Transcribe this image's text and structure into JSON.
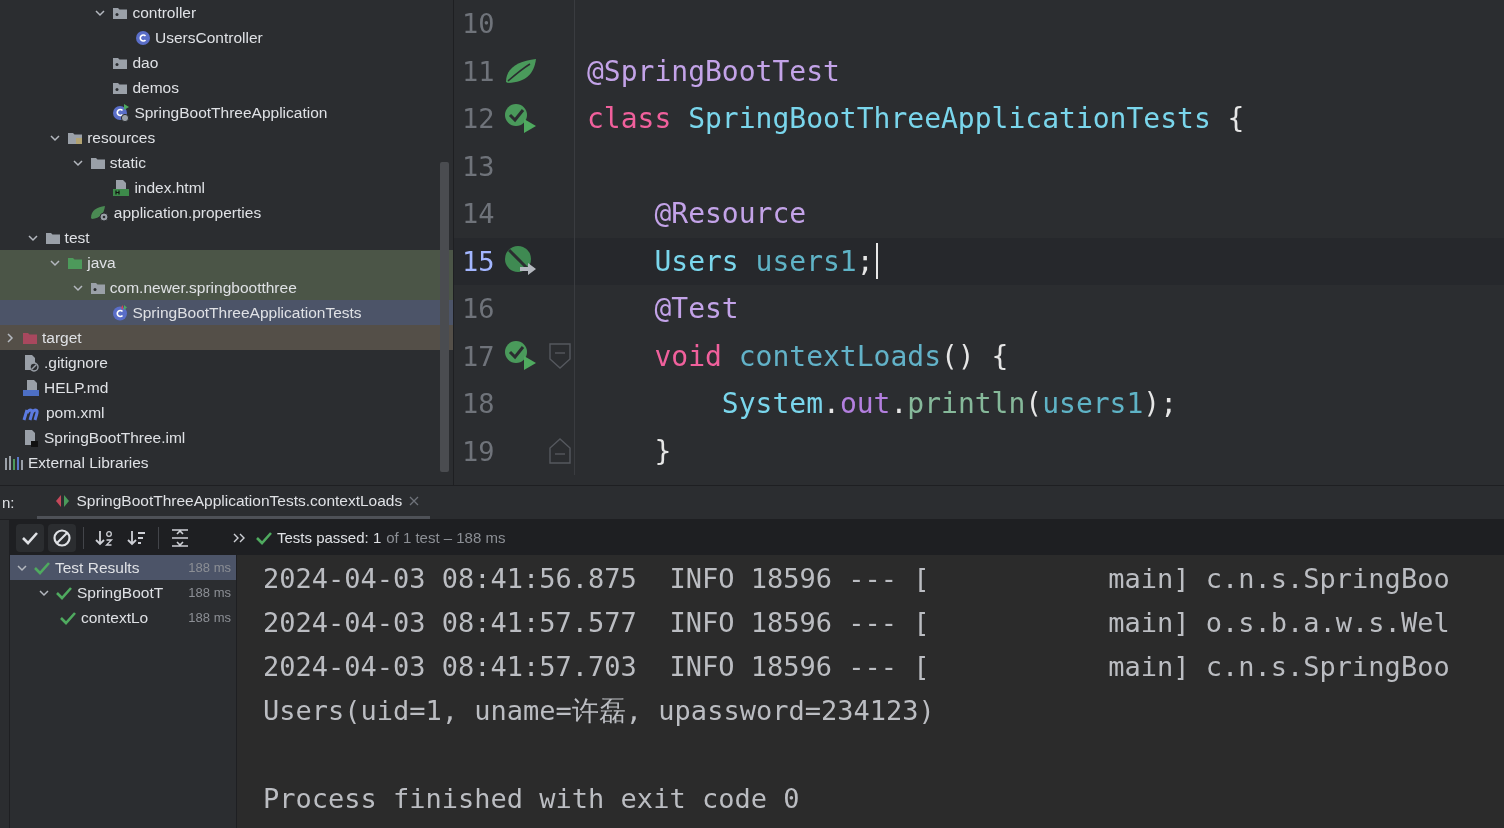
{
  "project_tree": {
    "items": [
      {
        "children": [
          {
            "children": [
              {
                "children": [
                  {
                    "children": [
                      {
                        "label": "controller",
                        "kind": "package",
                        "expanded": true,
                        "children": [
                          {
                            "label": "UsersController",
                            "kind": "class"
                          }
                        ]
                      },
                      {
                        "label": "dao",
                        "kind": "package"
                      },
                      {
                        "label": "demos",
                        "kind": "package"
                      },
                      {
                        "label": "SpringBootThreeApplication",
                        "kind": "spring-app"
                      }
                    ]
                  }
                ]
              },
              {
                "label": "resources",
                "kind": "resources",
                "expanded": true,
                "children": [
                  {
                    "label": "static",
                    "kind": "folder",
                    "expanded": true,
                    "children": [
                      {
                        "label": "index.html",
                        "kind": "html"
                      }
                    ]
                  },
                  {
                    "label": "application.properties",
                    "kind": "properties"
                  }
                ]
              }
            ]
          },
          {
            "label": "test",
            "kind": "folder",
            "expanded": true,
            "children": [
              {
                "label": "java",
                "kind": "test-root",
                "expanded": true,
                "test_source": true,
                "children": [
                  {
                    "label": "com.newer.springbootthree",
                    "kind": "package",
                    "expanded": true,
                    "test_source": true,
                    "children": [
                      {
                        "label": "SpringBootThreeApplicationTests",
                        "kind": "test-class",
                        "selected": true
                      }
                    ]
                  }
                ]
              }
            ]
          }
        ]
      },
      {
        "label": "target",
        "kind": "excluded",
        "expanded": false,
        "excluded": true
      },
      {
        "label": ".gitignore",
        "kind": "ignore-file"
      },
      {
        "label": "HELP.md",
        "kind": "markdown"
      },
      {
        "label": "pom.xml",
        "kind": "maven"
      },
      {
        "label": "SpringBootThree.iml",
        "kind": "module-file"
      },
      {
        "label": "External Libraries",
        "kind": "libraries",
        "root": true
      }
    ]
  },
  "editor": {
    "lines": [
      {
        "number": "10"
      },
      {
        "number": "11",
        "spring_marker": true,
        "tokens": [
          {
            "text": "@SpringBootTest",
            "kind": "annotation"
          }
        ]
      },
      {
        "number": "12",
        "run_marker": true,
        "tokens": [
          {
            "text": "class",
            "kind": "keyword"
          },
          {
            "text": " SpringBootThreeApplicationTests",
            "kind": "class"
          },
          {
            "text": " {",
            "kind": "plain"
          }
        ]
      },
      {
        "number": "13"
      },
      {
        "number": "14",
        "tokens": [
          {
            "text": "    @Resource",
            "kind": "annotation"
          }
        ]
      },
      {
        "number": "15",
        "bean_marker": true,
        "current": true,
        "caret": true,
        "tokens": [
          {
            "text": "    Users",
            "kind": "class"
          },
          {
            "text": " users1",
            "kind": "field"
          },
          {
            "text": ";",
            "kind": "plain"
          }
        ]
      },
      {
        "number": "16",
        "tokens": [
          {
            "text": "    @Test",
            "kind": "annotation"
          }
        ]
      },
      {
        "number": "17",
        "run_marker": true,
        "fold_start": true,
        "tokens": [
          {
            "text": "    void",
            "kind": "keyword"
          },
          {
            "text": " contextLoads",
            "kind": "method"
          },
          {
            "text": "() {",
            "kind": "plain"
          }
        ]
      },
      {
        "number": "18",
        "tokens": [
          {
            "text": "        System",
            "kind": "class"
          },
          {
            "text": ".",
            "kind": "plain"
          },
          {
            "text": "out",
            "kind": "static"
          },
          {
            "text": ".",
            "kind": "plain"
          },
          {
            "text": "println",
            "kind": "call"
          },
          {
            "text": "(",
            "kind": "plain"
          },
          {
            "text": "users1",
            "kind": "field"
          },
          {
            "text": ");",
            "kind": "plain"
          }
        ]
      },
      {
        "number": "19",
        "fold_end": true,
        "tokens": [
          {
            "text": "    }",
            "kind": "plain"
          }
        ]
      }
    ]
  },
  "run_panel": {
    "label": "n:",
    "tabs": [
      {
        "label": "SpringBootThreeApplicationTests.contextLoads",
        "selected": true,
        "closable": true
      }
    ],
    "toolbar": [
      {
        "kind": "show-passed",
        "on": true
      },
      {
        "kind": "show-ignored",
        "on": true
      },
      {
        "kind": "separator"
      },
      {
        "kind": "sort-alpha",
        "on": false
      },
      {
        "kind": "sort-duration",
        "on": false
      },
      {
        "kind": "separator"
      },
      {
        "kind": "expand",
        "on": false
      },
      {
        "kind": "more",
        "on": false
      }
    ],
    "status": {
      "summary": "Tests passed: 1",
      "detail": "of 1 test – 188 ms"
    },
    "results": [
      {
        "label": "Test Results",
        "time": "188 ms",
        "expanded": true,
        "selected": true,
        "children": [
          {
            "label": "SpringBootT",
            "time": "188 ms",
            "expanded": true,
            "selected": false,
            "children": [
              {
                "label": "contextLo",
                "time": "188 ms",
                "selected": false
              }
            ]
          }
        ]
      }
    ],
    "console": {
      "output": [
        {
          "text": "2024-04-03 08:41:56.875  INFO 18596 --- [           main] c.n.s.SpringBoo"
        },
        {
          "text": "2024-04-03 08:41:57.577  INFO 18596 --- [           main] o.s.b.a.w.s.Wel"
        },
        {
          "text": "2024-04-03 08:41:57.703  INFO 18596 --- [           main] c.n.s.SpringBoo"
        },
        {
          "text": "Users(uid=1, uname=许磊, upassword=234123)"
        }
      ],
      "exit_message": "Process finished with exit code 0"
    }
  }
}
